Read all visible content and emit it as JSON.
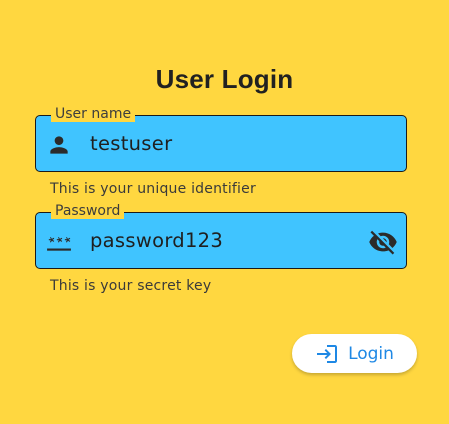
{
  "title": "User Login",
  "username": {
    "label": "User name",
    "value": "testuser",
    "helper": "This is your unique identifier",
    "icon": "person-icon"
  },
  "password": {
    "label": "Password",
    "value": "password123",
    "helper": "This is your secret key",
    "icon": "password-icon",
    "toggle_icon": "visibility-off-icon"
  },
  "login_button": {
    "label": "Login",
    "icon": "login-icon"
  },
  "colors": {
    "background": "#FFD740",
    "field_fill": "#40C4FF",
    "button_text": "#1E88E5"
  }
}
